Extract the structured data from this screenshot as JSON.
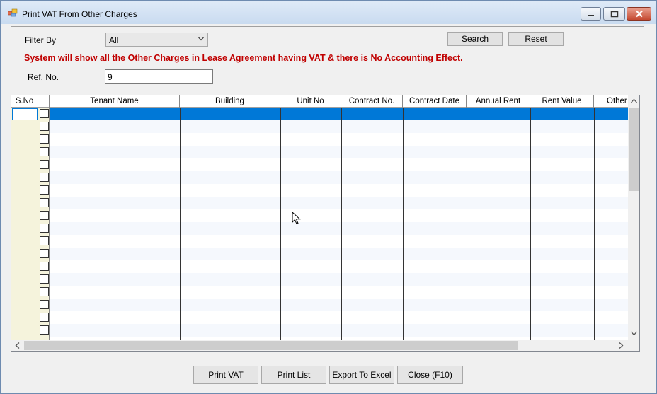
{
  "window": {
    "title": "Print VAT From Other Charges"
  },
  "filter": {
    "label": "Filter By",
    "value": "All",
    "search_label": "Search",
    "reset_label": "Reset",
    "warning": "System will  show all the Other Charges in Lease Agreement having VAT & there is No Accounting Effect."
  },
  "ref": {
    "label": "Ref. No.",
    "value": "9"
  },
  "grid": {
    "columns": [
      "S.No",
      "",
      "Tenant Name",
      "Building",
      "Unit No",
      "Contract No.",
      "Contract Date",
      "Annual Rent",
      "Rent Value",
      "Other"
    ]
  },
  "footer": {
    "print_vat": "Print VAT",
    "print_list": "Print List",
    "export_excel": "Export To Excel",
    "close": "Close (F10)"
  },
  "colors": {
    "selection": "#0078d7",
    "warning": "#c00000",
    "row_header": "#f5f3dc"
  }
}
